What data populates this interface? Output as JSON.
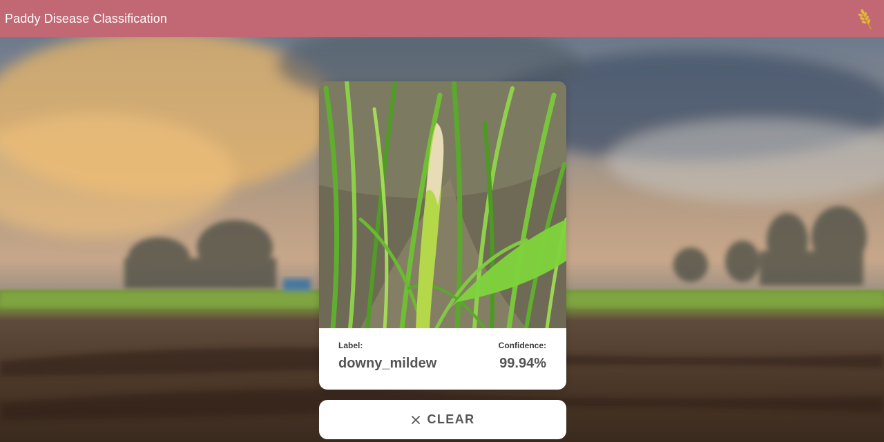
{
  "app": {
    "title": "Paddy Disease Classification",
    "logo_icon": "wheat-icon",
    "accent_color": "#c26774"
  },
  "background": {
    "subject": "blurred-farm-field-photo"
  },
  "card": {
    "image_icon": "rice-plant-photo",
    "result": {
      "label_caption": "Label:",
      "label_value": "downy_mildew",
      "confidence_caption": "Confidence:",
      "confidence_value": "99.94%"
    }
  },
  "actions": {
    "clear_label": "CLEAR",
    "clear_icon": "close-icon"
  }
}
